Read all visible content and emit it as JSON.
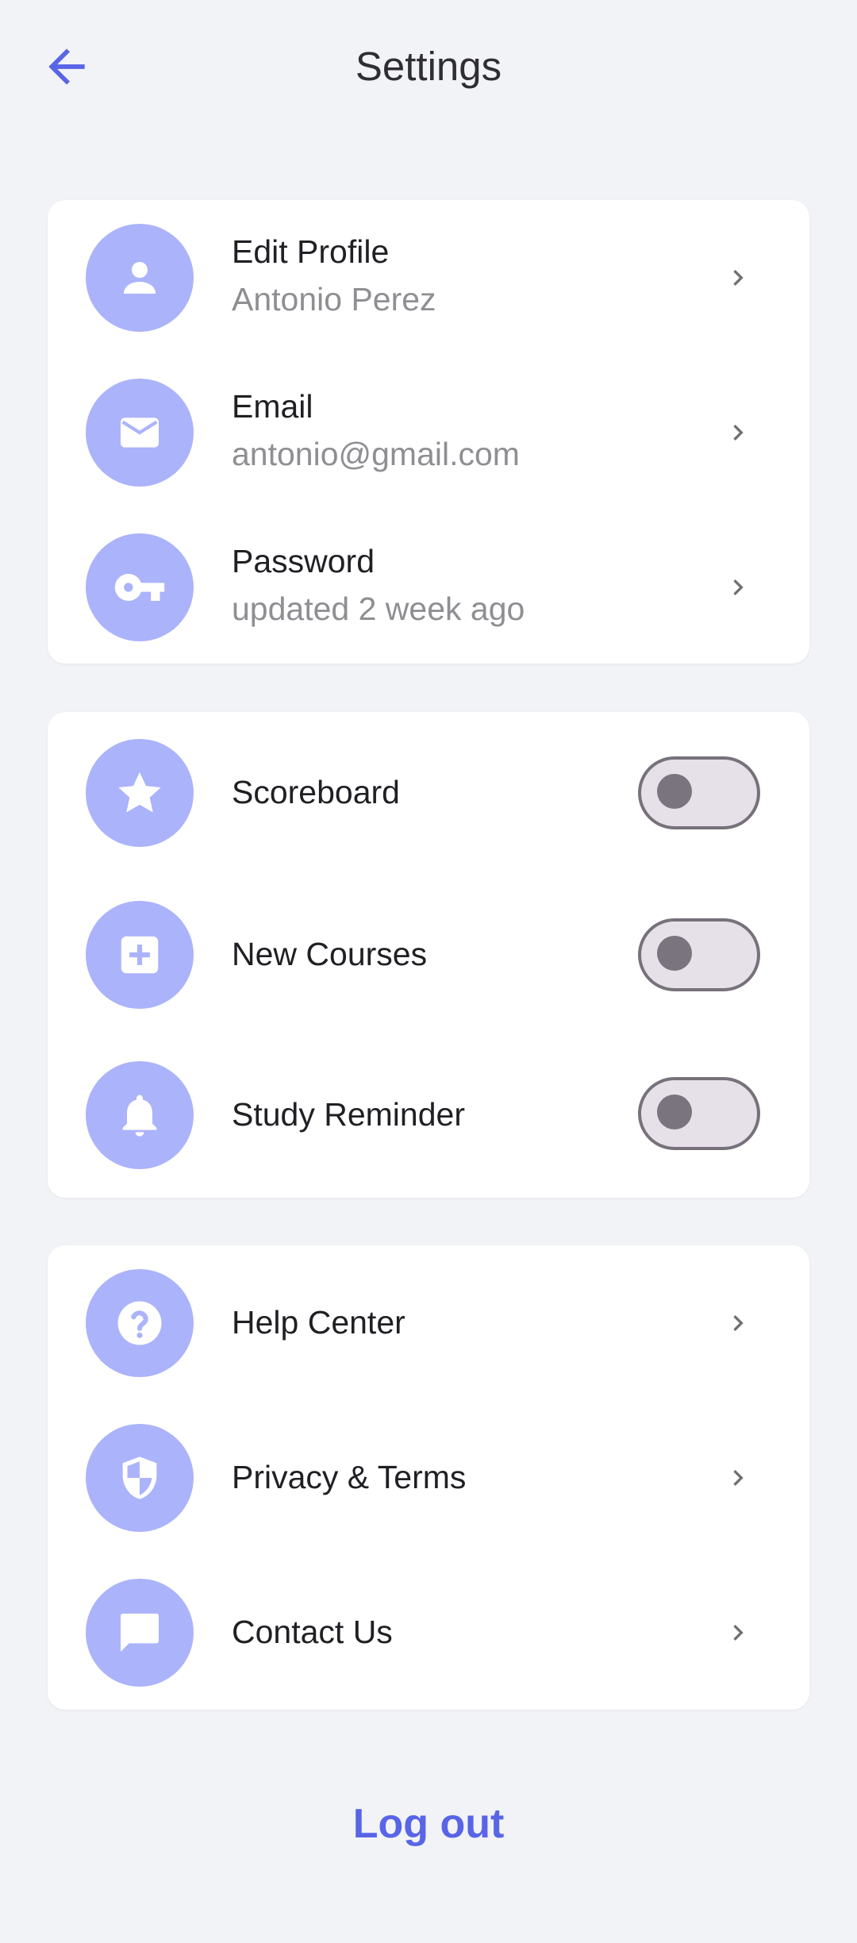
{
  "header": {
    "title": "Settings",
    "back_icon": "arrow-left-icon",
    "accent_color": "#5865e6"
  },
  "account": {
    "items": [
      {
        "title": "Edit Profile",
        "subtitle": "Antonio Perez",
        "icon": "person-icon"
      },
      {
        "title": "Email",
        "subtitle": "antonio@gmail.com",
        "icon": "envelope-icon"
      },
      {
        "title": "Password",
        "subtitle": "updated 2 week ago",
        "icon": "key-icon"
      }
    ]
  },
  "notifications": {
    "items": [
      {
        "title": "Scoreboard",
        "icon": "star-icon",
        "enabled": false
      },
      {
        "title": "New Courses",
        "icon": "plus-box-icon",
        "enabled": false
      },
      {
        "title": "Study Reminder",
        "icon": "bell-icon",
        "enabled": false
      }
    ]
  },
  "support": {
    "items": [
      {
        "title": "Help Center",
        "icon": "help-circle-icon"
      },
      {
        "title": "Privacy & Terms",
        "icon": "shield-icon"
      },
      {
        "title": "Contact Us",
        "icon": "chat-bubble-icon"
      }
    ]
  },
  "logout": {
    "label": "Log out"
  },
  "colors": {
    "background": "#f2f3f7",
    "icon_circle": "#abb3fb",
    "accent": "#5865e6"
  }
}
